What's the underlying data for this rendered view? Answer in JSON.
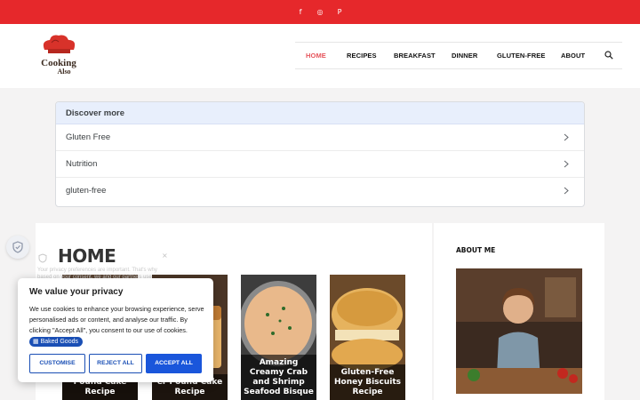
{
  "topbar": {
    "icons": [
      "facebook-icon",
      "instagram-icon",
      "pinterest-icon"
    ],
    "glyphs": [
      "f",
      "◎",
      "P"
    ]
  },
  "logo": {
    "line1": "Cooking",
    "line2": "Also"
  },
  "nav": {
    "items": [
      {
        "label": "HOME"
      },
      {
        "label": "RECIPES"
      },
      {
        "label": "BREAKFAST"
      },
      {
        "label": "DINNER"
      },
      {
        "label": "GLUTEN-FREE"
      },
      {
        "label": "ABOUT"
      }
    ]
  },
  "discover": {
    "title": "Discover more",
    "items": [
      {
        "label": "Gluten Free"
      },
      {
        "label": "Nutrition"
      },
      {
        "label": "gluten-free"
      }
    ]
  },
  "main": {
    "title": "HOME"
  },
  "cards": [
    {
      "title": "Pound Cake Recipe"
    },
    {
      "title": "er Pound Cake Recipe"
    },
    {
      "title": "Amazing Creamy Crab and Shrimp Seafood Bisque"
    },
    {
      "title": "Gluten-Free Honey Biscuits Recipe"
    }
  ],
  "sidebar": {
    "about_title": "ABOUT ME"
  },
  "background_notice": {
    "text": "Your privacy preferences are important. That's why based on your consent, we and our partners use and process (some) personal data such as IP address for ads and service"
  },
  "cookie": {
    "title": "We value your privacy",
    "body": "We use cookies to enhance your browsing experience, serve personalised ads or content, and analyse our traffic. By clicking \"Accept All\", you consent to our use of cookies.",
    "badge": "Baked Goods",
    "customise": "CUSTOMISE",
    "reject": "REJECT ALL",
    "accept": "ACCEPT ALL"
  },
  "colors": {
    "brand_red": "#e6282b",
    "nav_active": "#e6545b",
    "cookie_blue": "#1a56db"
  }
}
